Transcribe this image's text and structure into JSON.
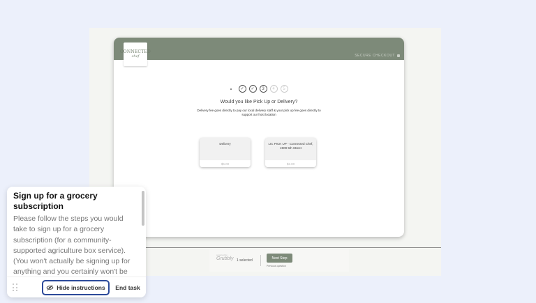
{
  "checkout": {
    "logo_line1": "CONNECTED",
    "logo_line2": "chef",
    "secure_label": "SECURE CHECKOUT",
    "steps": [
      "✓",
      "✓",
      "3",
      "4",
      "5"
    ],
    "question": "Would you like Pick Up or Delivery?",
    "note": "Delivery fee goes directly to pay our local delivery staff & your pick up fee goes directly to support our host location",
    "options": [
      {
        "name": "Delivery",
        "price": "$6.00"
      },
      {
        "name": "LIC PICK UP - Connected Chef, 4909 5th Street",
        "price": "$2.00"
      }
    ]
  },
  "footer": {
    "brand_small": "powered by",
    "brand": "Grubbly",
    "selected": "1 selected",
    "next_label": "Next Step",
    "prev_label": "Previous question"
  },
  "instructions": {
    "title": "Sign up for a grocery subscription",
    "body": "Please follow the steps you would take to sign up for a grocery subscription (for a community-supported agriculture box service). (You won't actually be signing up for anything and you certainly won't be charged.)",
    "hide_label": "Hide instructions",
    "end_label": "End task"
  },
  "colors": {
    "accent": "#7d8a79",
    "focus": "#2c4a9a"
  }
}
